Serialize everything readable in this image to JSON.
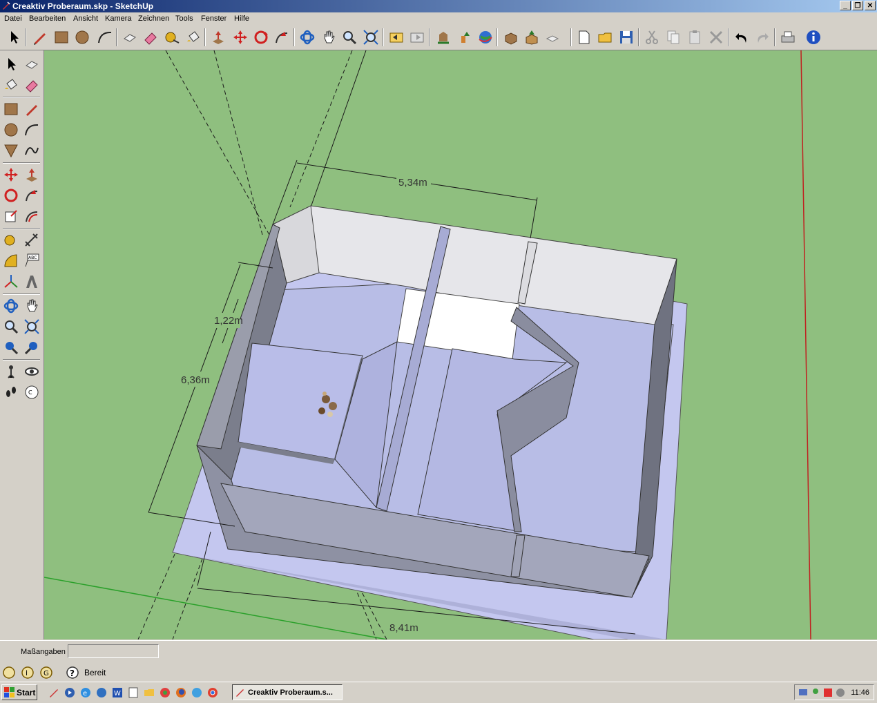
{
  "window": {
    "title": "Creaktiv Proberaum.skp - SketchUp",
    "buttons": [
      "_",
      "❐",
      "✕"
    ]
  },
  "menu": [
    "Datei",
    "Bearbeiten",
    "Ansicht",
    "Kamera",
    "Zeichnen",
    "Tools",
    "Fenster",
    "Hilfe"
  ],
  "toolbar_icons": [
    "select-icon",
    "pencil-icon",
    "rectangle-icon",
    "circle-icon",
    "arc-icon",
    "make-component-icon",
    "eraser-icon",
    "tape-measure-icon",
    "paint-bucket-icon",
    "push-pull-icon",
    "move-icon",
    "rotate-icon",
    "follow-me-icon",
    "orbit-icon",
    "pan-icon",
    "zoom-icon",
    "zoom-extents-icon",
    "previous-view-icon",
    "next-view-icon",
    "get-models-icon",
    "share-model-icon",
    "google-earth-icon",
    "import-icon",
    "export-icon",
    "components-icon",
    "new-icon",
    "open-icon",
    "save-icon",
    "cut-icon",
    "copy-icon",
    "paste-icon",
    "delete-icon",
    "undo-icon",
    "redo-icon",
    "print-icon",
    "info-icon"
  ],
  "dimensions": {
    "top": "5,34m",
    "left_outer": "6,36m",
    "left_inner": "1,22m",
    "bottom": "8,41m"
  },
  "colors": {
    "ground": "#8fbf7f",
    "face": "#b8bde6",
    "wall_top": "#e8e8ec",
    "wall_side": "#7b7e8c"
  },
  "measure": {
    "label": "Maßangaben",
    "value": ""
  },
  "status": {
    "text": "Bereit"
  },
  "taskbar": {
    "start": "Start",
    "task": "Creaktiv Proberaum.s...",
    "clock": "11:46"
  }
}
